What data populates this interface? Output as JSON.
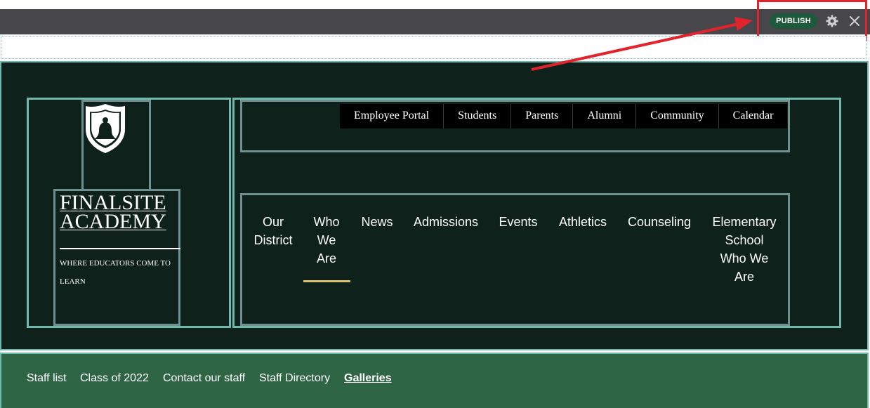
{
  "toolbar": {
    "publish_label": "PUBLISH",
    "settings_icon": "gear-icon",
    "close_icon": "close-icon"
  },
  "colors": {
    "toolbar_bg": "#46464b",
    "publish_bg": "#1d5a3b",
    "header_bg": "#0e211a",
    "outline_teal": "#6fb9ad",
    "subnav_bg": "#2e6545",
    "active_underline": "#d8c26a",
    "annotation_red": "#e1232b"
  },
  "brand": {
    "logo_icon": "shield-logo-icon",
    "name_line1": "FINALSITE",
    "name_line2": "ACADEMY",
    "tagline_line1": "WHERE EDUCATORS COME TO",
    "tagline_line2": "LEARN"
  },
  "utility_nav": [
    {
      "label": "Employee Portal"
    },
    {
      "label": "Students"
    },
    {
      "label": "Parents"
    },
    {
      "label": "Alumni"
    },
    {
      "label": "Community"
    },
    {
      "label": "Calendar"
    }
  ],
  "main_nav": {
    "our_district": {
      "line1": "Our",
      "line2": "District"
    },
    "who_we_are": {
      "line1": "Who",
      "line2": "We",
      "line3": "Are"
    },
    "news": "News",
    "admissions": "Admissions",
    "events": "Events",
    "athletics": "Athletics",
    "counseling": "Counseling",
    "elementary": {
      "line1": "Elementary",
      "line2": "School",
      "line3": "Who We",
      "line4": "Are"
    }
  },
  "sub_nav": [
    {
      "label": "Staff list"
    },
    {
      "label": "Class of 2022"
    },
    {
      "label": "Contact our staff"
    },
    {
      "label": "Staff Directory"
    },
    {
      "label": "Galleries"
    }
  ]
}
